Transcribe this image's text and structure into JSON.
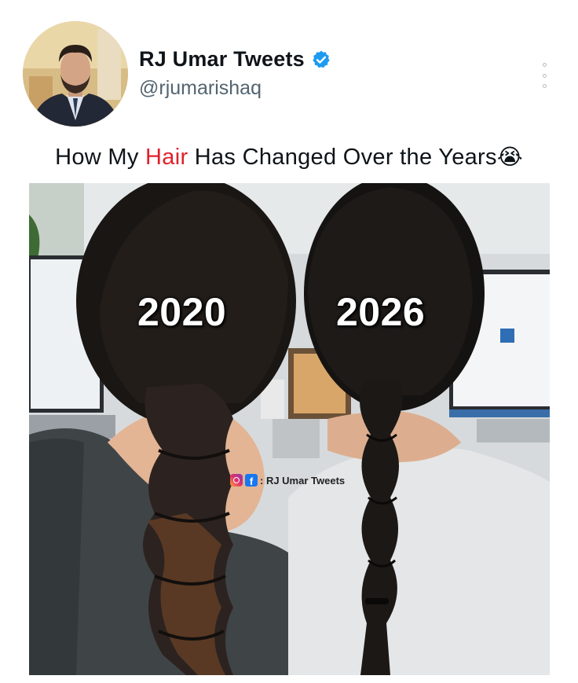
{
  "post": {
    "author": {
      "display_name": "RJ Umar Tweets",
      "handle": "@rjumarishaq",
      "verified": true,
      "avatar_icon": "profile-photo"
    },
    "more_icon": "vertical-ellipsis-icon",
    "caption": {
      "before": "How My ",
      "highlight": "Hair",
      "after": " Has Changed Over the Years",
      "emoji": "😭",
      "highlight_color": "#e0212b"
    },
    "image": {
      "label_left": "2020",
      "label_right": "2026",
      "watermark": {
        "icons": [
          "instagram-icon",
          "facebook-icon"
        ],
        "fb_glyph": "f",
        "text": ": RJ Umar Tweets"
      }
    }
  },
  "colors": {
    "verified_badge": "#1d9bf0",
    "text_primary": "#0f1419",
    "text_secondary": "#536471"
  }
}
